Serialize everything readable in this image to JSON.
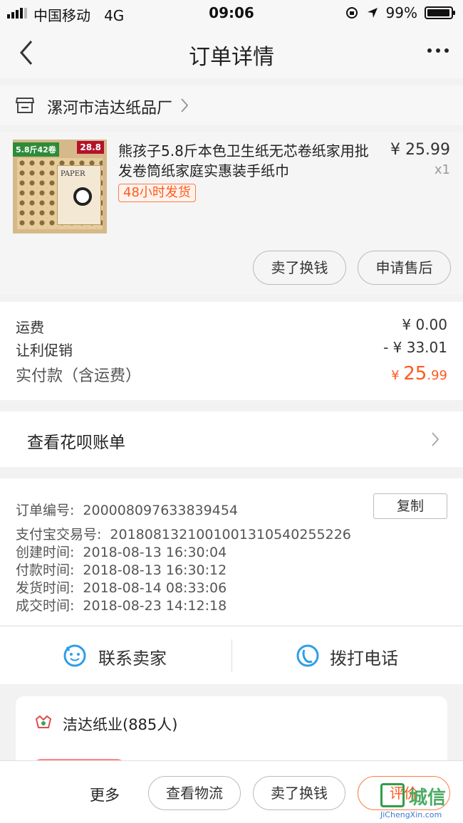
{
  "status_bar": {
    "carrier": "中国移动",
    "network": "4G",
    "time": "09:06",
    "battery": "99%"
  },
  "nav": {
    "title": "订单详情"
  },
  "shop": {
    "name": "漯河市洁达纸品厂"
  },
  "item": {
    "thumb_tag_left": "5.8斤42卷",
    "thumb_tag_right": "28.8",
    "thumb_pack_label": "PAPER",
    "title": "熊孩子5.8斤本色卫生纸无芯卷纸家用批发卷筒纸家庭实惠装手纸巾",
    "price": "¥ 25.99",
    "qty": "x1",
    "badge": "48小时发货",
    "actions": [
      "卖了换钱",
      "申请售后"
    ]
  },
  "fees": {
    "shipping_label": "运费",
    "shipping_value": "¥ 0.00",
    "discount_label": "让利促销",
    "discount_value": "- ¥ 33.01",
    "total_label": "实付款（含运费）",
    "total_currency": "¥ ",
    "total_int": "25",
    "total_dec": ".99"
  },
  "huabei": {
    "label": "查看花呗账单"
  },
  "order_info": {
    "order_no_label": "订单编号:",
    "order_no": "200008097633839454",
    "copy_label": "复制",
    "alipay_label": "支付宝交易号:",
    "alipay_no": "2018081321001001310540255226",
    "created_label": "创建时间:",
    "created": "2018-08-13 16:30:04",
    "paid_label": "付款时间:",
    "paid": "2018-08-13 16:30:12",
    "shipped_label": "发货时间:",
    "shipped": "2018-08-14 08:33:06",
    "done_label": "成交时间:",
    "done": "2018-08-23 14:12:18"
  },
  "contact": {
    "seller_label": "联系卖家",
    "call_label": "拨打电话"
  },
  "brand": {
    "name": "洁达纸业(885人)"
  },
  "bottom_bar": {
    "more": "更多",
    "logistics": "查看物流",
    "resell": "卖了换钱",
    "review": "评价"
  },
  "watermark": {
    "text": "城信",
    "url": "JiChengXin.com"
  },
  "colors": {
    "accent": "#ff5a1f",
    "bg": "#f2f2f2",
    "link_blue": "#2f9ee6"
  }
}
